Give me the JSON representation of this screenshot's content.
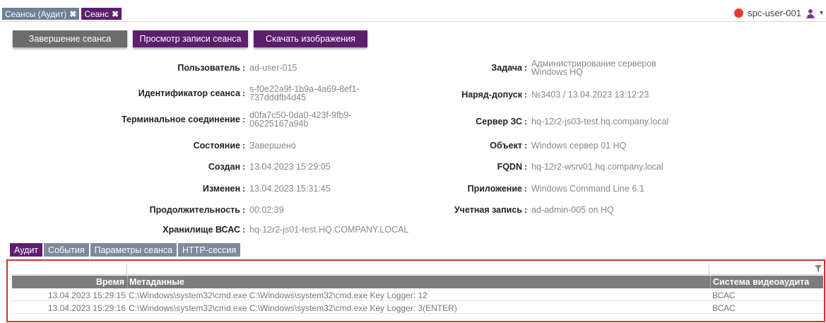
{
  "tabs": [
    {
      "label": "Сеансы (Аудит)"
    },
    {
      "label": "Сеанс"
    }
  ],
  "user": {
    "name": "spc-user-001",
    "status_color": "#e53935"
  },
  "actions": {
    "end_session": "Завершение сеанса",
    "view_recording": "Просмотр записи сеанса",
    "download_images": "Скачать изображения"
  },
  "fields_left": [
    {
      "label": "Пользователь",
      "value_lines": [
        "ad-user-015"
      ]
    },
    {
      "label": "Идентификатор сеанса",
      "value_lines": [
        "s-f0e22a9f-1b9a-4a69-8ef1-",
        "737dddfb4d45"
      ]
    },
    {
      "label": "Терминальное соединение",
      "value_lines": [
        "d0fa7c50-0da0-423f-9fb9-",
        "06225167a94b"
      ]
    },
    {
      "label": "Состояние",
      "value_lines": [
        "Завершено"
      ]
    },
    {
      "label": "Создан",
      "value_lines": [
        "13.04.2023 15:29:05"
      ]
    },
    {
      "label": "Изменен",
      "value_lines": [
        "13.04.2023 15:31:45"
      ]
    },
    {
      "label": "Продолжительность",
      "value_lines": [
        "00:02:39"
      ]
    },
    {
      "label": "Хранилище ВСАС",
      "value_lines": [
        "hq-12r2-js01-test.HQ.COMPANY.LOCAL"
      ]
    }
  ],
  "fields_right": [
    {
      "label": "Задача",
      "value_lines": [
        "Администрирование серверов",
        "Windows HQ"
      ]
    },
    {
      "label": "Наряд-допуск",
      "value_lines": [
        "№3403 / 13.04.2023 13:12:23"
      ]
    },
    {
      "label": "Сервер ЗС",
      "value_lines": [
        "hq-12r2-js03-test.hq.company.local"
      ]
    },
    {
      "label": "Объект",
      "value_lines": [
        "Windows сервер 01 HQ"
      ]
    },
    {
      "label": "FQDN",
      "value_lines": [
        "hq-12r2-wsrv01.hq.company.local"
      ]
    },
    {
      "label": "Приложение",
      "value_lines": [
        "Windows Command Line 6.1"
      ]
    },
    {
      "label": "Учетная запись",
      "value_lines": [
        "ad-admin-005 on HQ"
      ]
    }
  ],
  "subtabs": [
    {
      "label": "Аудит",
      "active": true
    },
    {
      "label": "События",
      "active": false
    },
    {
      "label": "Параметры сеанса",
      "active": false
    },
    {
      "label": "HTTP-сессия",
      "active": false
    }
  ],
  "audit_table": {
    "columns": [
      "Время",
      "Метаданные",
      "Система видеоаудита"
    ],
    "rows": [
      [
        "13.04.2023 15:29:15",
        "C:\\Windows\\system32\\cmd.exe C:\\Windows\\system32\\cmd.exe Key Logger: 12",
        "ВСАС"
      ],
      [
        "13.04.2023 15:29:16",
        "C:\\Windows\\system32\\cmd.exe C:\\Windows\\system32\\cmd.exe Key Logger: 3(ENTER)",
        "ВСАС"
      ]
    ]
  },
  "colors": {
    "accent": "#5b1f6d",
    "tab_inactive": "#6e7f96",
    "highlight_border": "#d32f2f"
  }
}
